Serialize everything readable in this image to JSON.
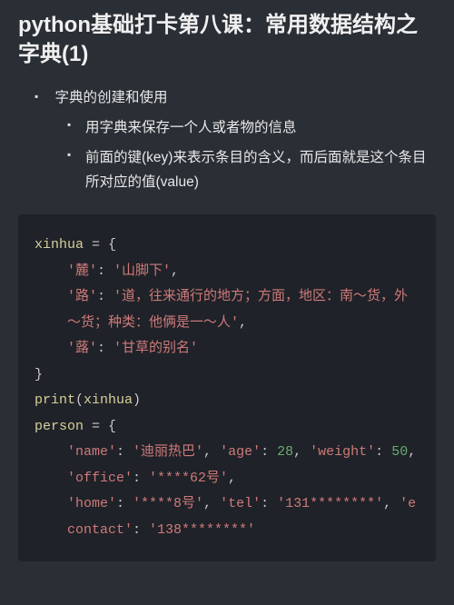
{
  "title": "python基础打卡第八课：常用数据结构之字典(1)",
  "bullets": {
    "top": "字典的创建和使用",
    "inner": [
      "用字典来保存一个人或者物的信息",
      "前面的键(key)来表示条目的含义，而后面就是这个条目所对应的值(value)"
    ]
  },
  "code": {
    "var1": "xinhua",
    "assign": " = ",
    "lbrace": "{",
    "rbrace": "}",
    "colon": ": ",
    "comma": ",",
    "entries1": [
      {
        "key": "'麓'",
        "val": "'山脚下'"
      },
      {
        "key": "'路'",
        "val": "'道，往来通行的地方；方面，地区：南～货，外～货；种类：他俩是一～人'"
      },
      {
        "key": "'蕗'",
        "val": "'甘草的别名'"
      }
    ],
    "printFn": "print",
    "printArg": "xinhua",
    "var2": "person",
    "entries2": [
      {
        "key": "'name'",
        "val": "'迪丽热巴'"
      },
      {
        "key": "'age'",
        "val": "28",
        "num": true
      },
      {
        "key": "'weight'",
        "val": "50",
        "num": true
      },
      {
        "key": "'office'",
        "val": "'****62号'"
      },
      {
        "key": "'home'",
        "val": "'****8号'"
      },
      {
        "key": "'tel'",
        "val": "'131********'"
      },
      {
        "key": "'econtact'",
        "val": "'138********'"
      }
    ]
  }
}
